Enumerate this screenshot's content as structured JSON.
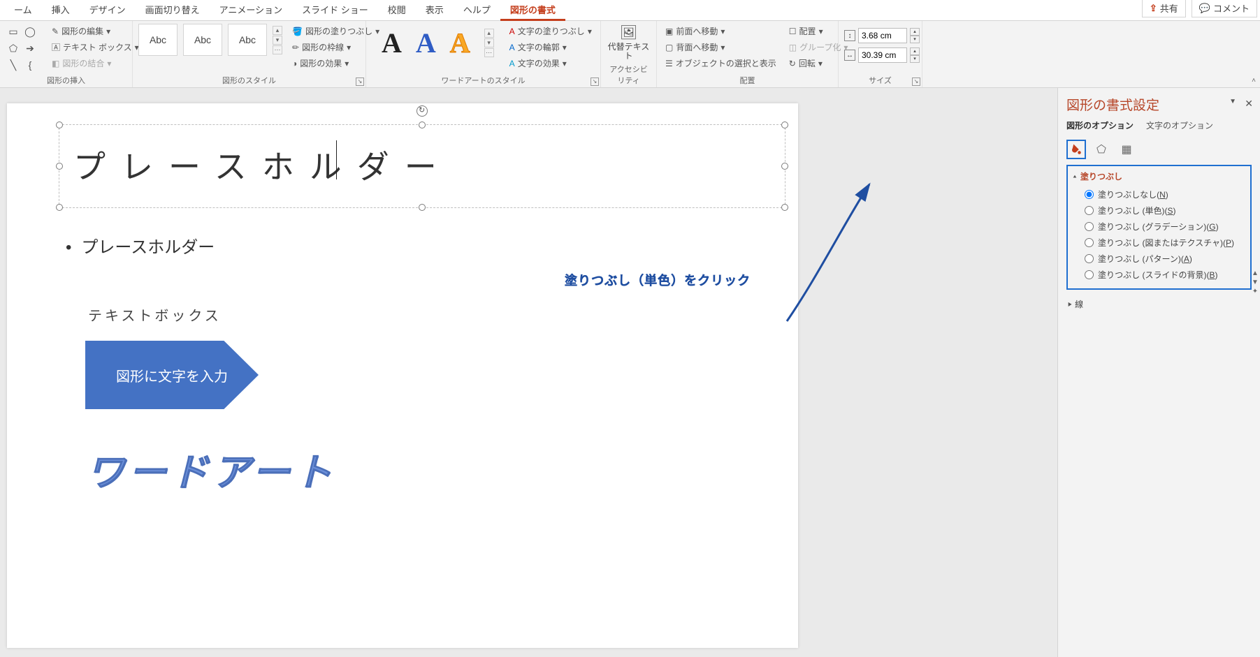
{
  "menu": {
    "tabs": [
      "ーム",
      "挿入",
      "デザイン",
      "画面切り替え",
      "アニメーション",
      "スライド ショー",
      "校閲",
      "表示",
      "ヘルプ",
      "図形の書式"
    ],
    "activeIndex": 9,
    "share": "共有",
    "comment": "コメント"
  },
  "ribbon": {
    "shapes_group": "図形の挿入",
    "edit_shape": "図形の編集",
    "text_box": "テキスト ボックス",
    "merge_shapes": "図形の結合",
    "styles_group": "図形のスタイル",
    "style_thumb": "Abc",
    "shape_fill": "図形の塗りつぶし",
    "shape_outline": "図形の枠線",
    "shape_effects": "図形の効果",
    "wordart_group": "ワードアートのスタイル",
    "text_fill": "文字の塗りつぶし",
    "text_outline": "文字の輪郭",
    "text_effects": "文字の効果",
    "accessibility_group": "アクセシビリティ",
    "alt_text": "代替テキスト",
    "arrange_group": "配置",
    "bring_forward": "前面へ移動",
    "send_backward": "背面へ移動",
    "selection_pane": "オブジェクトの選択と表示",
    "align": "配置",
    "group": "グループ化",
    "rotate": "回転",
    "size_group": "サイズ",
    "height": "3.68 cm",
    "width": "30.39 cm"
  },
  "slide": {
    "title": "プレースホルダー",
    "bullet": "プレースホルダー",
    "textbox_label": "テキストボックス",
    "arrow_text": "図形に文字を入力",
    "wordart": "ワードアート"
  },
  "annotation": "塗りつぶし（単色）をクリック",
  "pane": {
    "title": "図形の書式設定",
    "tab_shape": "図形のオプション",
    "tab_text": "文字のオプション",
    "section_fill": "塗りつぶし",
    "fill_none": "塗りつぶしなし",
    "fill_none_k": "N",
    "fill_solid": "塗りつぶし (単色)",
    "fill_solid_k": "S",
    "fill_grad": "塗りつぶし (グラデーション)",
    "fill_grad_k": "G",
    "fill_pic": "塗りつぶし (図またはテクスチャ)",
    "fill_pic_k": "P",
    "fill_pat": "塗りつぶし (パターン)",
    "fill_pat_k": "A",
    "fill_bg": "塗りつぶし (スライドの背景)",
    "fill_bg_k": "B",
    "section_line": "線"
  }
}
